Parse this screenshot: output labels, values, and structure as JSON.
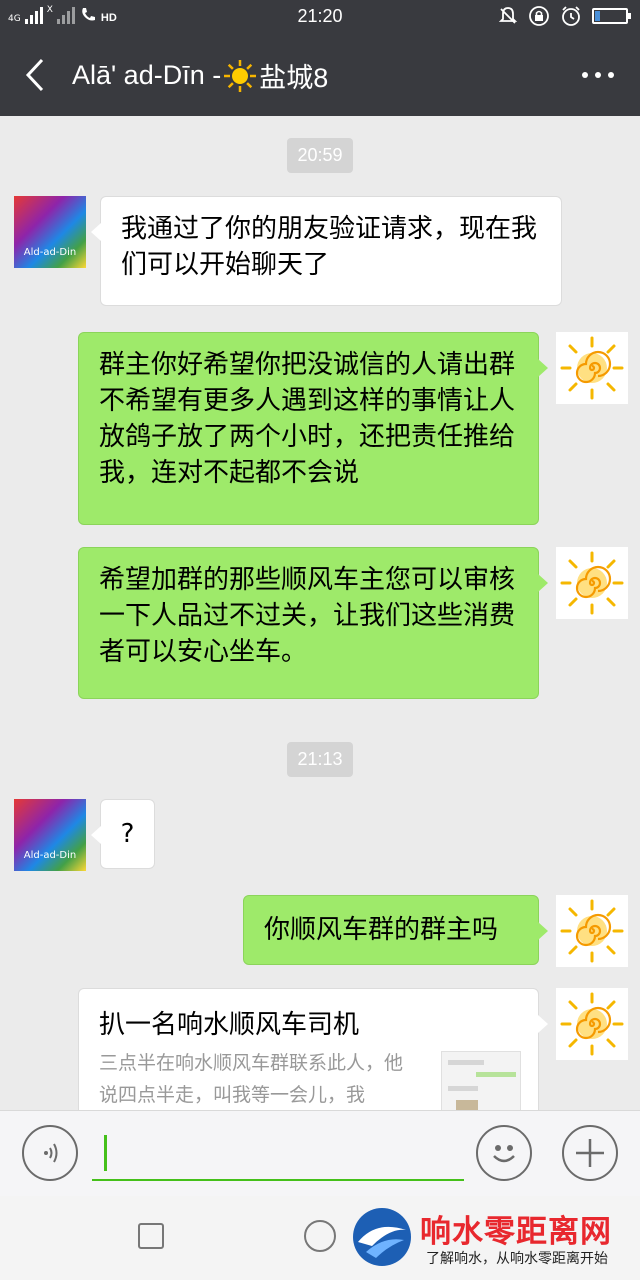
{
  "status_bar": {
    "time": "21:20",
    "network_top": "4G",
    "network_bottom": "X",
    "hd_label": "HD",
    "battery_level": 0.15,
    "icons": [
      "signal-icon",
      "wifi-off-icon",
      "hd-call-icon",
      "mute-icon",
      "lock-rotation-icon",
      "alarm-icon",
      "battery-icon"
    ]
  },
  "header": {
    "title_prefix": "Alā' ad-Dīn -",
    "title_suffix": "盐城8",
    "title_emoji": "sun-icon",
    "back_icon": "back-arrow-icon",
    "more_icon": "more-icon"
  },
  "messages": [
    {
      "type": "timestamp",
      "text": "20:59"
    },
    {
      "type": "text",
      "side": "left",
      "text": "我通过了你的朋友验证请求，现在我们可以开始聊天了"
    },
    {
      "type": "text",
      "side": "right",
      "text": "群主你好希望你把没诚信的人请出群不希望有更多人遇到这样的事情让人放鸽子放了两个小时，还把责任推给我，连对不起都不会说"
    },
    {
      "type": "text",
      "side": "right",
      "text": "希望加群的那些顺风车主您可以审核一下人品过不过关，让我们这些消费者可以安心坐车。"
    },
    {
      "type": "timestamp",
      "text": "21:13"
    },
    {
      "type": "text",
      "side": "left",
      "text": "?"
    },
    {
      "type": "text",
      "side": "right",
      "text": "你顺风车群的群主吗"
    },
    {
      "type": "card",
      "side": "right",
      "title": "扒一名响水顺风车司机",
      "desc": "三点半在响水顺风车群联系此人，他说四点半走，叫我等一会儿，我"
    }
  ],
  "contact": {
    "avatar_label": "Ald-ad-Din"
  },
  "input_bar": {
    "value": "",
    "voice_icon": "voice-icon",
    "emoji_icon": "emoji-icon",
    "plus_icon": "plus-icon"
  },
  "nav_bar": {
    "recent_icon": "recent-apps-icon",
    "home_icon": "home-icon"
  },
  "watermark": {
    "title": "响水零距离网",
    "subtitle": "了解响水，从响水零距离开始"
  },
  "colors": {
    "bar": "#393a3f",
    "bubble_right": "#9eea6a",
    "bubble_left": "#ffffff",
    "accent": "#45c01a",
    "watermark": "#e8282e"
  }
}
